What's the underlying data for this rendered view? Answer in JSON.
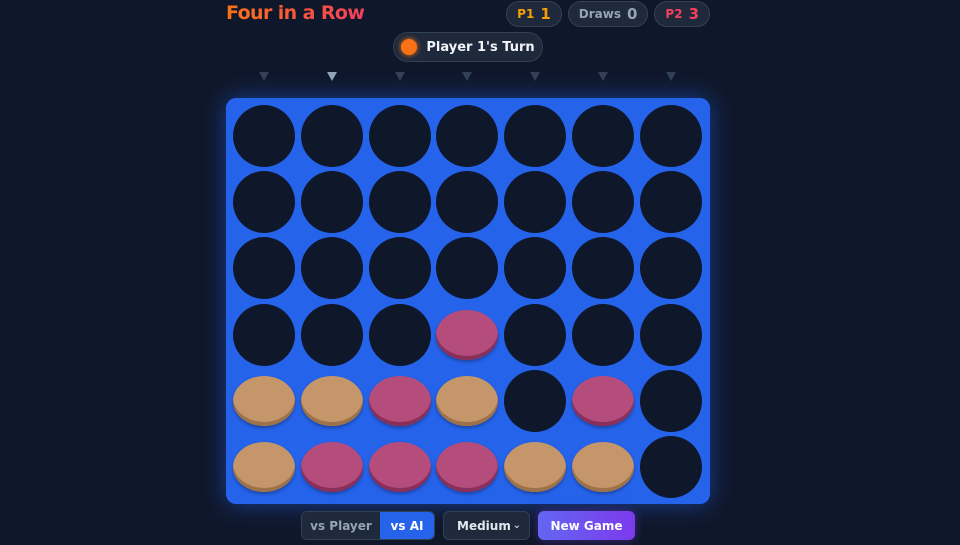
{
  "title": "Four in a Row",
  "scores": {
    "p1_label": "P1",
    "p1_value": "1",
    "draws_label": "Draws",
    "draws_value": "0",
    "p2_label": "P2",
    "p2_value": "3"
  },
  "turn": {
    "text": "Player 1's Turn",
    "color": "#f97316"
  },
  "board": {
    "columns": 7,
    "rows": 6,
    "hover_column": 1,
    "grid": [
      [
        0,
        0,
        0,
        0,
        0,
        0,
        0
      ],
      [
        0,
        0,
        0,
        0,
        0,
        0,
        0
      ],
      [
        0,
        0,
        0,
        0,
        0,
        0,
        0
      ],
      [
        0,
        0,
        0,
        2,
        0,
        0,
        0
      ],
      [
        1,
        1,
        2,
        1,
        0,
        2,
        0
      ],
      [
        1,
        2,
        2,
        2,
        1,
        1,
        0
      ]
    ],
    "board_color": "#2563eb",
    "player1_color": "#c4966a",
    "player2_color": "#b44d7c"
  },
  "controls": {
    "vs_player_label": "vs Player",
    "vs_ai_label": "vs AI",
    "active_mode": "vs AI",
    "difficulty_label": "Medium",
    "new_game_label": "New Game"
  }
}
